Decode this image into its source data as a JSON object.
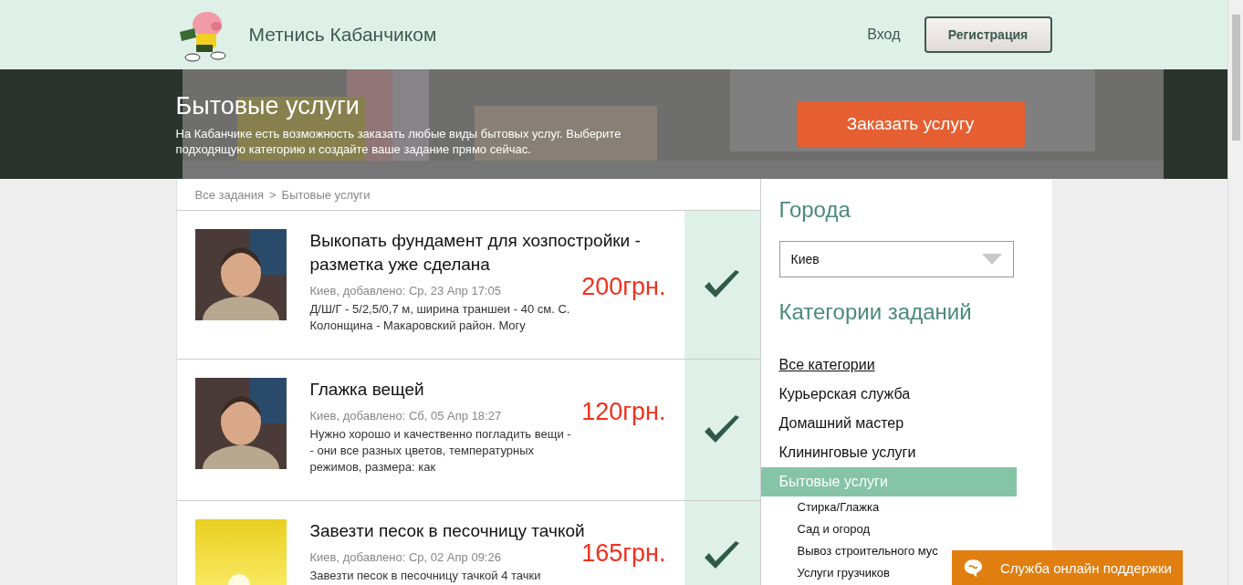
{
  "header": {
    "brand": "Метнись Кабанчиком",
    "login": "Вход",
    "register": "Регистрация"
  },
  "banner": {
    "title": "Бытовые услуги",
    "text": "На Кабанчике есть возможность заказать любые виды бытовых услуг. Выберите подходящую категорию и создайте ваше задание прямо сейчас.",
    "order_button": "Заказать услугу"
  },
  "breadcrumbs": [
    "Все задания",
    "Бытовые услуги"
  ],
  "breadcrumb_separator": ">",
  "tasks": [
    {
      "kind": "person",
      "title": "Выкопать фундамент для хозпостройки - разметка уже сделана",
      "meta": "Киев, добавлено: Ср, 23 Апр 17:05",
      "price": "200грн.",
      "description": "Д/Ш/Г - 5/2,5/0,7 м, ширина траншеи - 40 см. С. Колонщина - Макаровский район. Могу"
    },
    {
      "kind": "person",
      "title": "Глажка вещей",
      "meta": "Киев, добавлено: Сб, 05 Апр 18:27",
      "price": "120грн.",
      "description": "Нужно хорошо и качественно погладить вещи -- они все разных цветов, температурных режимов, размера: как"
    },
    {
      "kind": "sunset",
      "title": "Завезти песок в песочницу тачкой",
      "meta": "Киев, добавлено: Ср, 02 Апр 09:26",
      "price": "165грн.",
      "description": "Завезти песок в песочницу тачкой 4 тачки"
    }
  ],
  "sidebar": {
    "cities_title": "Города",
    "city": "Киев",
    "categories_title": "Категории заданий",
    "categories": [
      {
        "label": "Все категории",
        "selected": false,
        "underlined": true
      },
      {
        "label": "Курьерская служба",
        "selected": false,
        "underlined": false
      },
      {
        "label": "Домашний мастер",
        "selected": false,
        "underlined": false
      },
      {
        "label": "Клининговые услуги",
        "selected": false,
        "underlined": false
      },
      {
        "label": "Бытовые услуги",
        "selected": true,
        "underlined": false,
        "children": [
          {
            "label": "Стирка/Глажка"
          },
          {
            "label": "Сад и огород"
          },
          {
            "label": "Вывоз строительного мус"
          },
          {
            "label": "Услуги грузчиков"
          }
        ]
      }
    ]
  },
  "support_chat": {
    "label": "Служба онлайн поддержки"
  }
}
